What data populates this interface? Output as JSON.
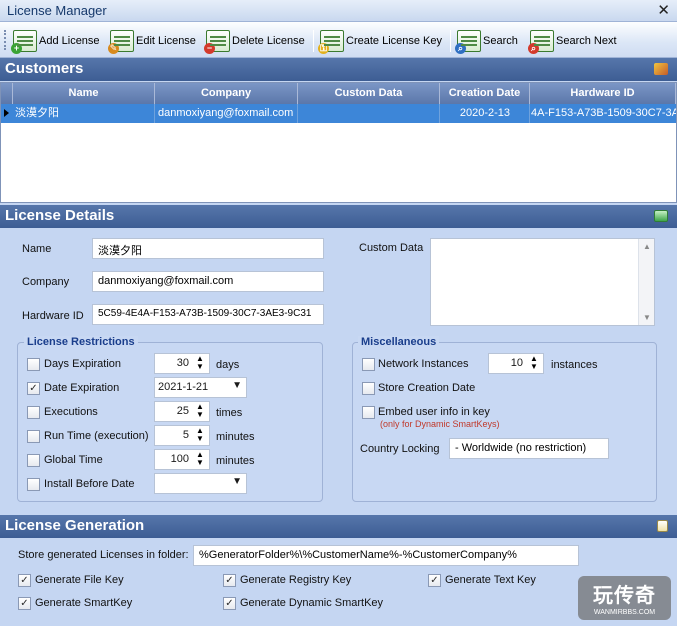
{
  "window": {
    "title": "License Manager",
    "close": "✕"
  },
  "toolbar": {
    "add_license": "Add License",
    "edit_license": "Edit License",
    "delete_license": "Delete License",
    "create_license_key": "Create License Key",
    "search": "Search",
    "search_next": "Search Next"
  },
  "customers": {
    "title": "Customers",
    "columns": [
      "Name",
      "Company",
      "Custom Data",
      "Creation Date",
      "Hardware ID"
    ],
    "rows": [
      {
        "name": "淡漠夕阳",
        "company": "danmoxiyang@foxmail.com",
        "custom_data": "",
        "creation_date": "2020-2-13",
        "hardware_id": "4A-F153-A73B-1509-30C7-3A"
      }
    ]
  },
  "details": {
    "title": "License Details",
    "name_label": "Name",
    "name_value": "淡漠夕阳",
    "company_label": "Company",
    "company_value": "danmoxiyang@foxmail.com",
    "hardware_label": "Hardware ID",
    "hardware_value": "5C59-4E4A-F153-A73B-1509-30C7-3AE3-9C31",
    "custom_data_label": "Custom Data",
    "custom_data_value": ""
  },
  "restrictions": {
    "title": "License Restrictions",
    "days_expiration": {
      "label": "Days Expiration",
      "checked": false,
      "value": "30",
      "unit": "days"
    },
    "date_expiration": {
      "label": "Date Expiration",
      "checked": true,
      "value": "2021-1-21"
    },
    "executions": {
      "label": "Executions",
      "checked": false,
      "value": "25",
      "unit": "times"
    },
    "run_time": {
      "label": "Run Time (execution)",
      "checked": false,
      "value": "5",
      "unit": "minutes"
    },
    "global_time": {
      "label": "Global Time",
      "checked": false,
      "value": "100",
      "unit": "minutes"
    },
    "install_before": {
      "label": "Install Before Date",
      "checked": false,
      "value": ""
    }
  },
  "misc": {
    "title": "Miscellaneous",
    "network_instances": {
      "label": "Network Instances",
      "checked": false,
      "value": "10",
      "unit": "instances"
    },
    "store_creation_date": {
      "label": "Store Creation Date",
      "checked": false
    },
    "embed_user_info": {
      "label": "Embed user info in key",
      "checked": false,
      "note": "(only for Dynamic SmartKeys)"
    },
    "country_locking_label": "Country Locking",
    "country_locking_value": "- Worldwide (no restriction)"
  },
  "generation": {
    "title": "License Generation",
    "folder_label": "Store generated Licenses in folder:",
    "folder_value": "%GeneratorFolder%\\%CustomerName%-%CustomerCompany%",
    "generate_file_key": {
      "label": "Generate File Key",
      "checked": true
    },
    "generate_registry_key": {
      "label": "Generate Registry Key",
      "checked": true
    },
    "generate_text_key": {
      "label": "Generate Text Key",
      "checked": true
    },
    "generate_smartkey": {
      "label": "Generate SmartKey",
      "checked": true
    },
    "generate_dynamic_smartkey": {
      "label": "Generate Dynamic SmartKey",
      "checked": true
    }
  },
  "watermark": {
    "brand": "玩传奇",
    "url": "WANMIRBBS.COM"
  },
  "colors": {
    "band": "#4a6aa0",
    "selection": "#3d86d8",
    "background": "#c5d6f2"
  }
}
